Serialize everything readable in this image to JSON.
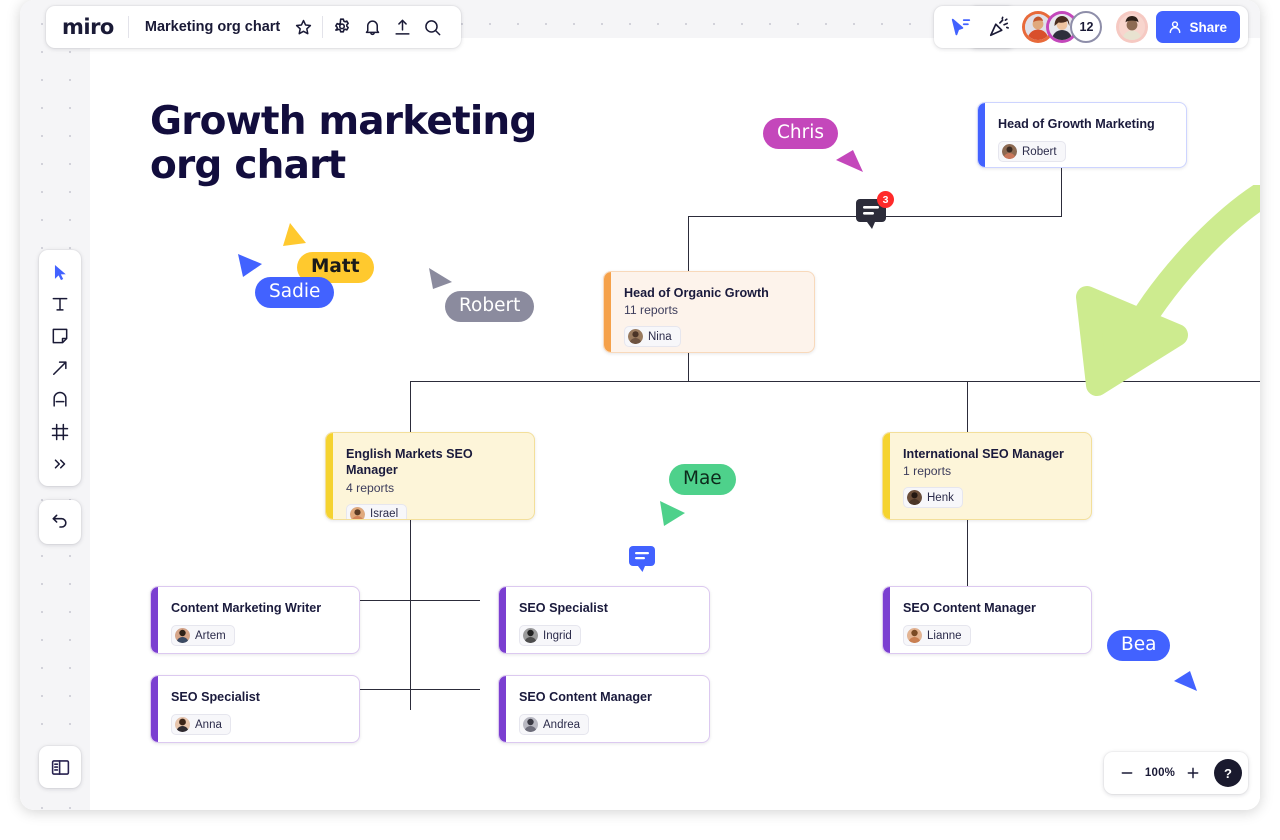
{
  "header": {
    "logo": "miro",
    "board_title": "Marketing org chart",
    "icons": [
      {
        "name": "star-icon",
        "glyph": "star"
      },
      {
        "name": "gear-icon",
        "glyph": "gear"
      },
      {
        "name": "bell-icon",
        "glyph": "bell"
      },
      {
        "name": "upload-icon",
        "glyph": "upload"
      },
      {
        "name": "search-icon",
        "glyph": "search"
      }
    ],
    "apps_icon": "apps-grid-icon",
    "present_icon": "presentation-icon",
    "celebrate_icon": "confetti-icon",
    "collaborators_count": "12",
    "share_label": "Share",
    "share_color": "#4262ff"
  },
  "toolbar": {
    "items": [
      {
        "name": "select-tool",
        "label": "Select"
      },
      {
        "name": "text-tool",
        "label": "Text"
      },
      {
        "name": "sticky-note-tool",
        "label": "Sticky note"
      },
      {
        "name": "shape-arrow-tool",
        "label": "Connection line"
      },
      {
        "name": "pen-tool",
        "label": "Pen"
      },
      {
        "name": "frame-tool",
        "label": "Frame"
      },
      {
        "name": "more-tools",
        "label": "More tools"
      }
    ],
    "undo_label": "Undo",
    "panel_toggle_label": "Toggle panel"
  },
  "zoom_controls": {
    "zoom_out_label": "Zoom out",
    "zoom_level": "100%",
    "zoom_in_label": "Zoom in",
    "help_label": "?"
  },
  "board": {
    "heading": "Growth marketing org chart",
    "nodes": [
      {
        "id": "head-growth-marketing",
        "title": "Head of Growth Marketing",
        "reports": "",
        "owner": "Robert",
        "color": "blue",
        "accent": "#4262ff"
      },
      {
        "id": "head-organic-growth",
        "title": "Head of Organic Growth",
        "reports": "11 reports",
        "owner": "Nina",
        "color": "orange",
        "accent": "#f5a14a"
      },
      {
        "id": "english-markets-seo-manager",
        "title": "English Markets SEO Manager",
        "reports": "4 reports",
        "owner": "Israel",
        "color": "yellow",
        "accent": "#f5d330"
      },
      {
        "id": "international-seo-manager",
        "title": "International SEO Manager",
        "reports": "1 reports",
        "owner": "Henk",
        "color": "yellow",
        "accent": "#f5d330"
      },
      {
        "id": "content-marketing-writer",
        "title": "Content Marketing Writer",
        "reports": "",
        "owner": "Artem",
        "color": "purple",
        "accent": "#7b3fd1"
      },
      {
        "id": "seo-specialist-ingrid",
        "title": "SEO Specialist",
        "reports": "",
        "owner": "Ingrid",
        "color": "purple",
        "accent": "#7b3fd1"
      },
      {
        "id": "seo-content-manager-lianne",
        "title": "SEO Content Manager",
        "reports": "",
        "owner": "Lianne",
        "color": "purple",
        "accent": "#7b3fd1"
      },
      {
        "id": "seo-specialist-anna",
        "title": "SEO Specialist",
        "reports": "",
        "owner": "Anna",
        "color": "purple",
        "accent": "#7b3fd1"
      },
      {
        "id": "seo-content-manager-andrea",
        "title": "SEO Content Manager",
        "reports": "",
        "owner": "Andrea",
        "color": "purple",
        "accent": "#7b3fd1"
      }
    ],
    "cursors": [
      {
        "name": "Chris",
        "bg": "#c447bb",
        "fg": "#ffffff"
      },
      {
        "name": "Matt",
        "bg": "#ffc92e",
        "fg": "#1a1a1a"
      },
      {
        "name": "Sadie",
        "bg": "#4262ff",
        "fg": "#ffffff"
      },
      {
        "name": "Robert",
        "bg": "#8b8b9e",
        "fg": "#ffffff"
      },
      {
        "name": "Mae",
        "bg": "#4ed18b",
        "fg": "#0d2a1c"
      },
      {
        "name": "Bea",
        "bg": "#4262ff",
        "fg": "#ffffff"
      }
    ],
    "comments": [
      {
        "id": "comment-pin-dark",
        "count": "3",
        "color": "#2c2c3a",
        "badge_color": "#ff2a2a"
      },
      {
        "id": "comment-pin-blue",
        "count": "",
        "color": "#4262ff",
        "badge_color": ""
      }
    ],
    "annotation": {
      "name": "green-arrow",
      "color": "#cdeb8f"
    }
  }
}
